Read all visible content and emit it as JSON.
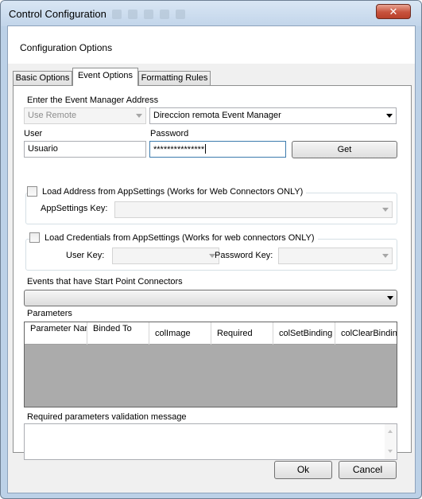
{
  "window": {
    "title": "Control Configuration",
    "close_symbol": "✕"
  },
  "header": {
    "title": "Configuration Options"
  },
  "tabs": [
    {
      "label": "Basic Options"
    },
    {
      "label": "Event Options"
    },
    {
      "label": "Formatting Rules"
    }
  ],
  "event_manager": {
    "section_label": "Enter the Event Manager Address",
    "mode_value": "Use Remote",
    "address_value": "Direccion remota Event Manager"
  },
  "credentials": {
    "user_label": "User",
    "user_value": "Usuario",
    "password_label": "Password",
    "password_value": "***************",
    "get_button": "Get"
  },
  "load_address": {
    "checkbox_label": "Load Address from AppSettings (Works for Web Connectors ONLY)",
    "key_label": "AppSettings Key:"
  },
  "load_credentials": {
    "checkbox_label": "Load Credentials from AppSettings (Works for web connectors ONLY)",
    "user_key_label": "User Key:",
    "password_key_label": "Password Key:"
  },
  "events": {
    "label": "Events that have Start Point Connectors"
  },
  "parameters": {
    "label": "Parameters",
    "columns": [
      "Parameter Name",
      "Binded To",
      "colImage",
      "Required",
      "colSetBinding",
      "colClearBinding"
    ]
  },
  "validation": {
    "label": "Required parameters validation message"
  },
  "footer": {
    "ok_label": "Ok",
    "cancel_label": "Cancel"
  }
}
